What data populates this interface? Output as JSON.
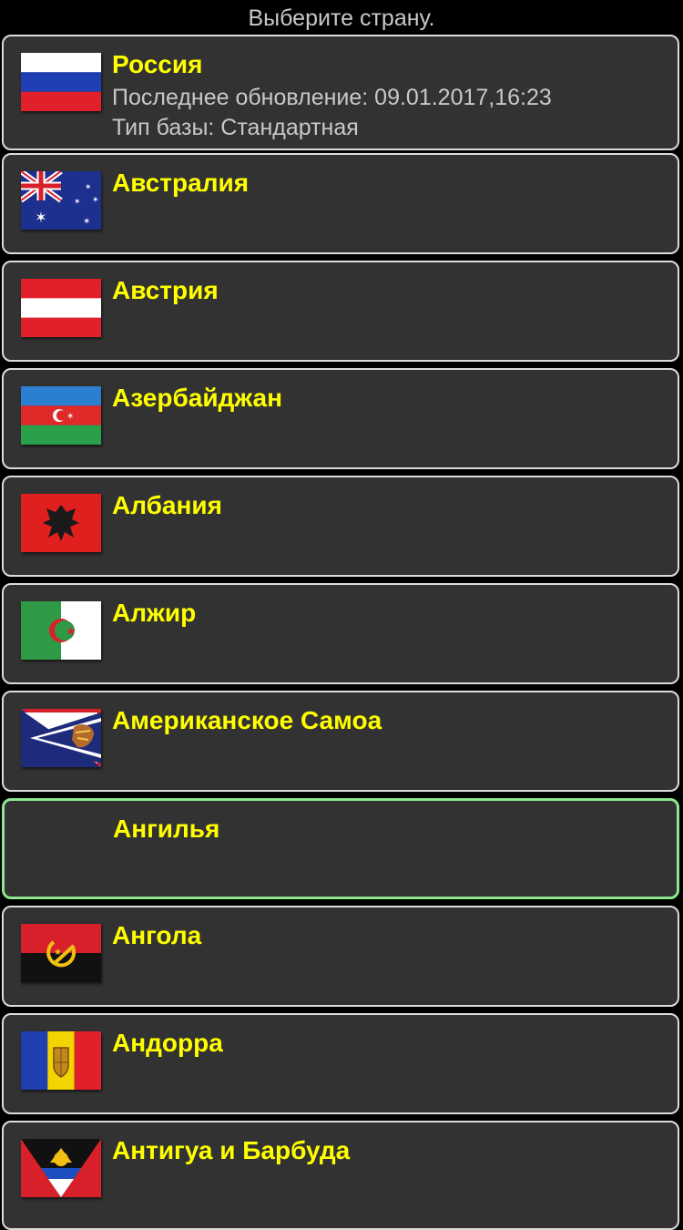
{
  "header": {
    "title": "Выберите страну."
  },
  "countries": [
    {
      "name": "Россия",
      "flag_icon": "russia-flag-icon",
      "update_line": "Последнее обновление: 09.01.2017,16:23",
      "base_line": "Тип базы: Стандартная"
    },
    {
      "name": "Австралия",
      "flag_icon": "australia-flag-icon"
    },
    {
      "name": "Австрия",
      "flag_icon": "austria-flag-icon"
    },
    {
      "name": "Азербайджан",
      "flag_icon": "azerbaijan-flag-icon"
    },
    {
      "name": "Албания",
      "flag_icon": "albania-flag-icon"
    },
    {
      "name": "Алжир",
      "flag_icon": "algeria-flag-icon"
    },
    {
      "name": "Американское Самоа",
      "flag_icon": "american-samoa-flag-icon"
    },
    {
      "name": "Ангилья",
      "flag_icon": "",
      "selected": true
    },
    {
      "name": "Ангола",
      "flag_icon": "angola-flag-icon"
    },
    {
      "name": "Андорра",
      "flag_icon": "andorra-flag-icon"
    },
    {
      "name": "Антигуа и Барбуда",
      "flag_icon": "antigua-barbuda-flag-icon"
    }
  ],
  "colors": {
    "background": "#000000",
    "row_background": "#323232",
    "row_border": "#dcdcdc",
    "selected_border": "#8ee68e",
    "country_name": "#ffff00",
    "secondary_text": "#c8c8c8"
  }
}
